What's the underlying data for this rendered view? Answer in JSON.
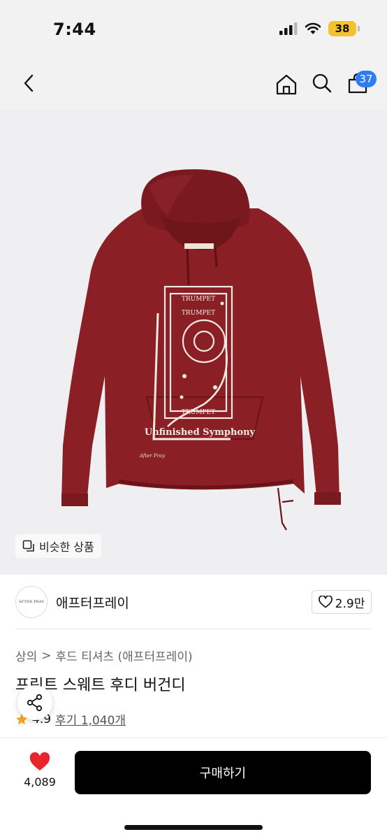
{
  "status_bar": {
    "time": "7:44",
    "battery": "38"
  },
  "nav": {
    "cart_count": "37"
  },
  "hero": {
    "similar_label": "비슷한 상품",
    "print_text": {
      "word": "TRUMPET",
      "tagline": "Unfinished Symphony",
      "signature": "After Pray"
    },
    "colors": {
      "hoodie": "#8a1f25",
      "hoodie_dark": "#6f161b",
      "print": "#f3e9e2"
    }
  },
  "brand": {
    "logo_text": "AFTER PRAY",
    "name": "애프터프레이",
    "likes": "2.9만"
  },
  "breadcrumb": {
    "category": "상의",
    "separator": ">",
    "subcategory": "후드 티셔츠 (애프터프레이)"
  },
  "product": {
    "title": "프린트 스웨트 후디 버건디",
    "rating": "4.9",
    "reviews": "후기 1,040개"
  },
  "bottom": {
    "wish_count": "4,089",
    "buy_label": "구매하기"
  },
  "colors": {
    "accent_blue": "#2f7cf6",
    "heart_red": "#e8242c",
    "star": "#f6a623",
    "battery": "#f6c12f"
  }
}
